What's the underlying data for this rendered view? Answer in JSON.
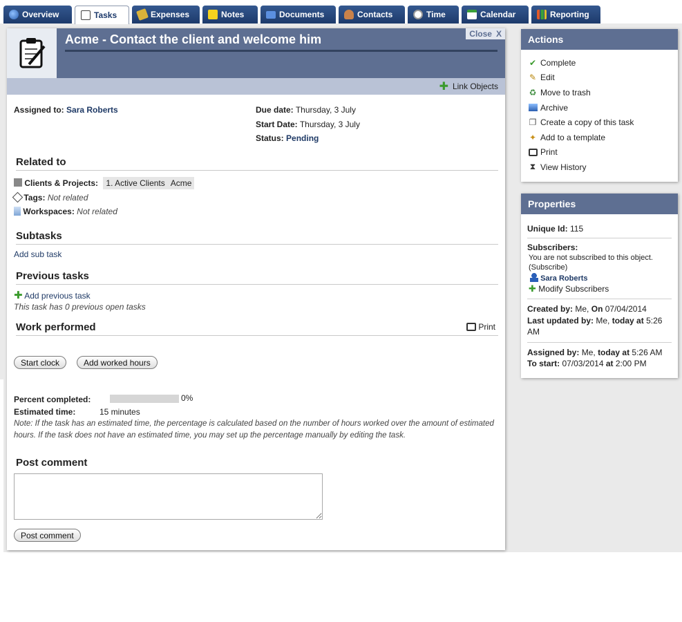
{
  "tabs": [
    {
      "label": "Overview",
      "icon": "globe-icon",
      "color": "#4a7fd0"
    },
    {
      "label": "Tasks",
      "icon": "task-list-icon",
      "color": "#555555",
      "active": true
    },
    {
      "label": "Expenses",
      "icon": "money-icon",
      "color": "#d9b23a"
    },
    {
      "label": "Notes",
      "icon": "sticky-note-icon",
      "color": "#f4d21e"
    },
    {
      "label": "Documents",
      "icon": "folder-icon",
      "color": "#3a72c8"
    },
    {
      "label": "Contacts",
      "icon": "person-icon",
      "color": "#c9824a"
    },
    {
      "label": "Time",
      "icon": "clock-icon",
      "color": "#dddddd"
    },
    {
      "label": "Calendar",
      "icon": "calendar-icon",
      "color": "#3aa03a"
    },
    {
      "label": "Reporting",
      "icon": "bar-chart-icon",
      "color": "#e05a2a"
    }
  ],
  "header": {
    "title": "Acme - Contact the client and welcome him",
    "close_label": "Close",
    "close_x": "X",
    "link_objects": "Link Objects"
  },
  "details": {
    "assigned_label": "Assigned to:",
    "assigned_value": "Sara Roberts",
    "due_label": "Due date:",
    "due_value": "Thursday, 3 July",
    "start_label": "Start Date:",
    "start_value": "Thursday, 3 July",
    "status_label": "Status:",
    "status_value": "Pending"
  },
  "related": {
    "title": "Related to",
    "clients_label": "Clients & Projects:",
    "clients_chip1": "1. Active Clients",
    "clients_chip2": "Acme",
    "tags_label": "Tags:",
    "tags_value": "Not related",
    "workspaces_label": "Workspaces:",
    "workspaces_value": "Not related"
  },
  "subtasks": {
    "title": "Subtasks",
    "add_label": "Add sub task"
  },
  "previous": {
    "title": "Previous tasks",
    "add_label": "Add previous task",
    "info": "This task has 0 previous open tasks"
  },
  "work": {
    "title": "Work performed",
    "print_label": "Print",
    "start_clock": "Start clock",
    "add_hours": "Add worked hours",
    "percent_label": "Percent completed:",
    "percent_value": "0%",
    "percent_fraction": 0,
    "estimated_label": "Estimated time:",
    "estimated_value": "15 minutes",
    "note": "Note: If the task has an estimated time, the percentage is calculated based on the number of hours worked over the amount of estimated hours. If the task does not have an estimated time, you may set up the percentage manually by editing the task."
  },
  "comment": {
    "title": "Post comment",
    "button": "Post comment"
  },
  "actions": {
    "title": "Actions",
    "items": [
      {
        "label": "Complete",
        "icon": "checkmark-icon"
      },
      {
        "label": "Edit",
        "icon": "edit-pencil-icon"
      },
      {
        "label": "Move to trash",
        "icon": "trash-icon"
      },
      {
        "label": "Archive",
        "icon": "archive-icon"
      },
      {
        "label": "Create a copy of this task",
        "icon": "copy-icon"
      },
      {
        "label": "Add to a template",
        "icon": "template-wand-icon"
      },
      {
        "label": "Print",
        "icon": "printer-icon"
      },
      {
        "label": "View History",
        "icon": "hourglass-icon"
      }
    ]
  },
  "properties": {
    "title": "Properties",
    "unique_label": "Unique Id:",
    "unique_value": "115",
    "subscribers_label": "Subscribers:",
    "not_subscribed": "You are not subscribed to this object.",
    "subscribe": "(Subscribe)",
    "subscriber_name": "Sara Roberts",
    "modify": "Modify Subscribers",
    "created_by_label": "Created by:",
    "created_by_value": "Me,",
    "created_on_label": "On",
    "created_on_value": "07/04/2014",
    "updated_label": "Last updated by:",
    "updated_value": "Me,",
    "updated_when": "today at",
    "updated_time": "5:26 AM",
    "assigned_by_label": "Assigned by:",
    "assigned_by_value": "Me,",
    "assigned_when": "today at",
    "assigned_time": "5:26 AM",
    "to_start_label": "To start:",
    "to_start_date": "07/03/2014",
    "to_start_at": "at",
    "to_start_time": "2:00 PM"
  }
}
